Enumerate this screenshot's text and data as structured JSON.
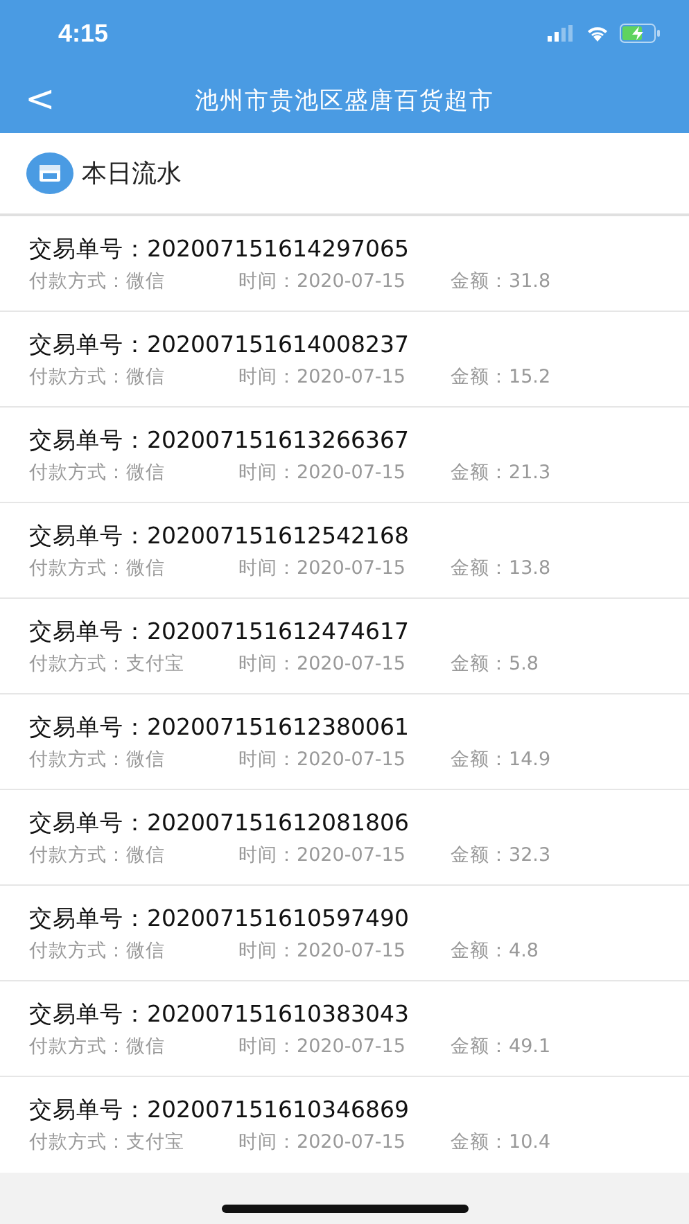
{
  "status_bar": {
    "time": "4:15"
  },
  "nav": {
    "back": "<",
    "title": "池州市贵池区盛唐百货超市"
  },
  "section": {
    "title": "本日流水"
  },
  "transactions": [
    {
      "order": "交易单号：202007151614297065",
      "payment": "付款方式：微信",
      "time": "时间：2020-07-15",
      "amount": "金额：31.8"
    },
    {
      "order": "交易单号：202007151614008237",
      "payment": "付款方式：微信",
      "time": "时间：2020-07-15",
      "amount": "金额：15.2"
    },
    {
      "order": "交易单号：202007151613266367",
      "payment": "付款方式：微信",
      "time": "时间：2020-07-15",
      "amount": "金额：21.3"
    },
    {
      "order": "交易单号：202007151612542168",
      "payment": "付款方式：微信",
      "time": "时间：2020-07-15",
      "amount": "金额：13.8"
    },
    {
      "order": "交易单号：202007151612474617",
      "payment": "付款方式：支付宝",
      "time": "时间：2020-07-15",
      "amount": "金额：5.8"
    },
    {
      "order": "交易单号：202007151612380061",
      "payment": "付款方式：微信",
      "time": "时间：2020-07-15",
      "amount": "金额：14.9"
    },
    {
      "order": "交易单号：202007151612081806",
      "payment": "付款方式：微信",
      "time": "时间：2020-07-15",
      "amount": "金额：32.3"
    },
    {
      "order": "交易单号：202007151610597490",
      "payment": "付款方式：微信",
      "time": "时间：2020-07-15",
      "amount": "金额：4.8"
    },
    {
      "order": "交易单号：202007151610383043",
      "payment": "付款方式：微信",
      "time": "时间：2020-07-15",
      "amount": "金额：49.1"
    },
    {
      "order": "交易单号：202007151610346869",
      "payment": "付款方式：支付宝",
      "time": "时间：2020-07-15",
      "amount": "金额：10.4"
    }
  ]
}
